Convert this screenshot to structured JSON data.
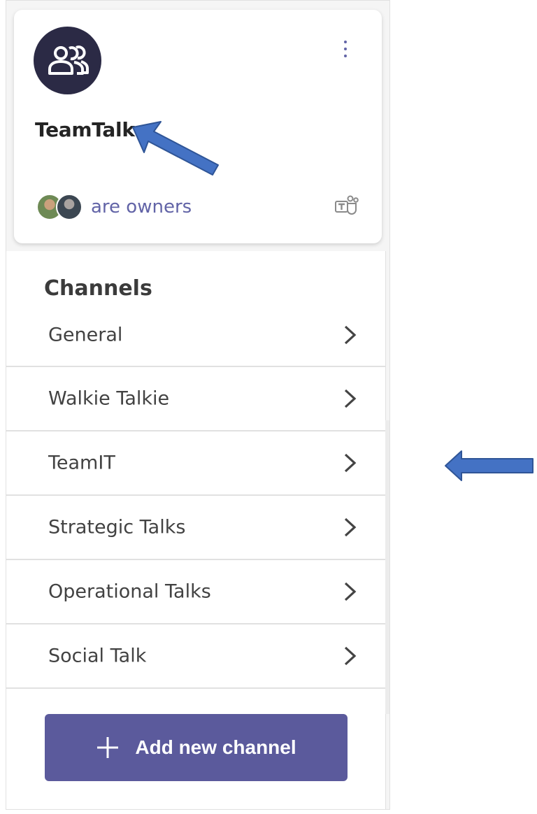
{
  "team": {
    "name": "TeamTalk",
    "owners_text": "are owners",
    "icon": "people-group-icon",
    "more_icon": "more-vertical-icon",
    "app_icon": "teams-logo-icon"
  },
  "channels": {
    "heading": "Channels",
    "items": [
      {
        "label": "General"
      },
      {
        "label": "Walkie Talkie"
      },
      {
        "label": "TeamIT"
      },
      {
        "label": "Strategic Talks"
      },
      {
        "label": "Operational Talks"
      },
      {
        "label": "Social Talk"
      }
    ],
    "chevron_icon": "chevron-right-icon"
  },
  "add_channel": {
    "label": "Add new channel",
    "icon": "plus-icon"
  },
  "colors": {
    "accent": "#6264a7",
    "button": "#5b5a9c",
    "avatar_bg": "#2b2a45",
    "callout_arrow": "#4472c4"
  }
}
